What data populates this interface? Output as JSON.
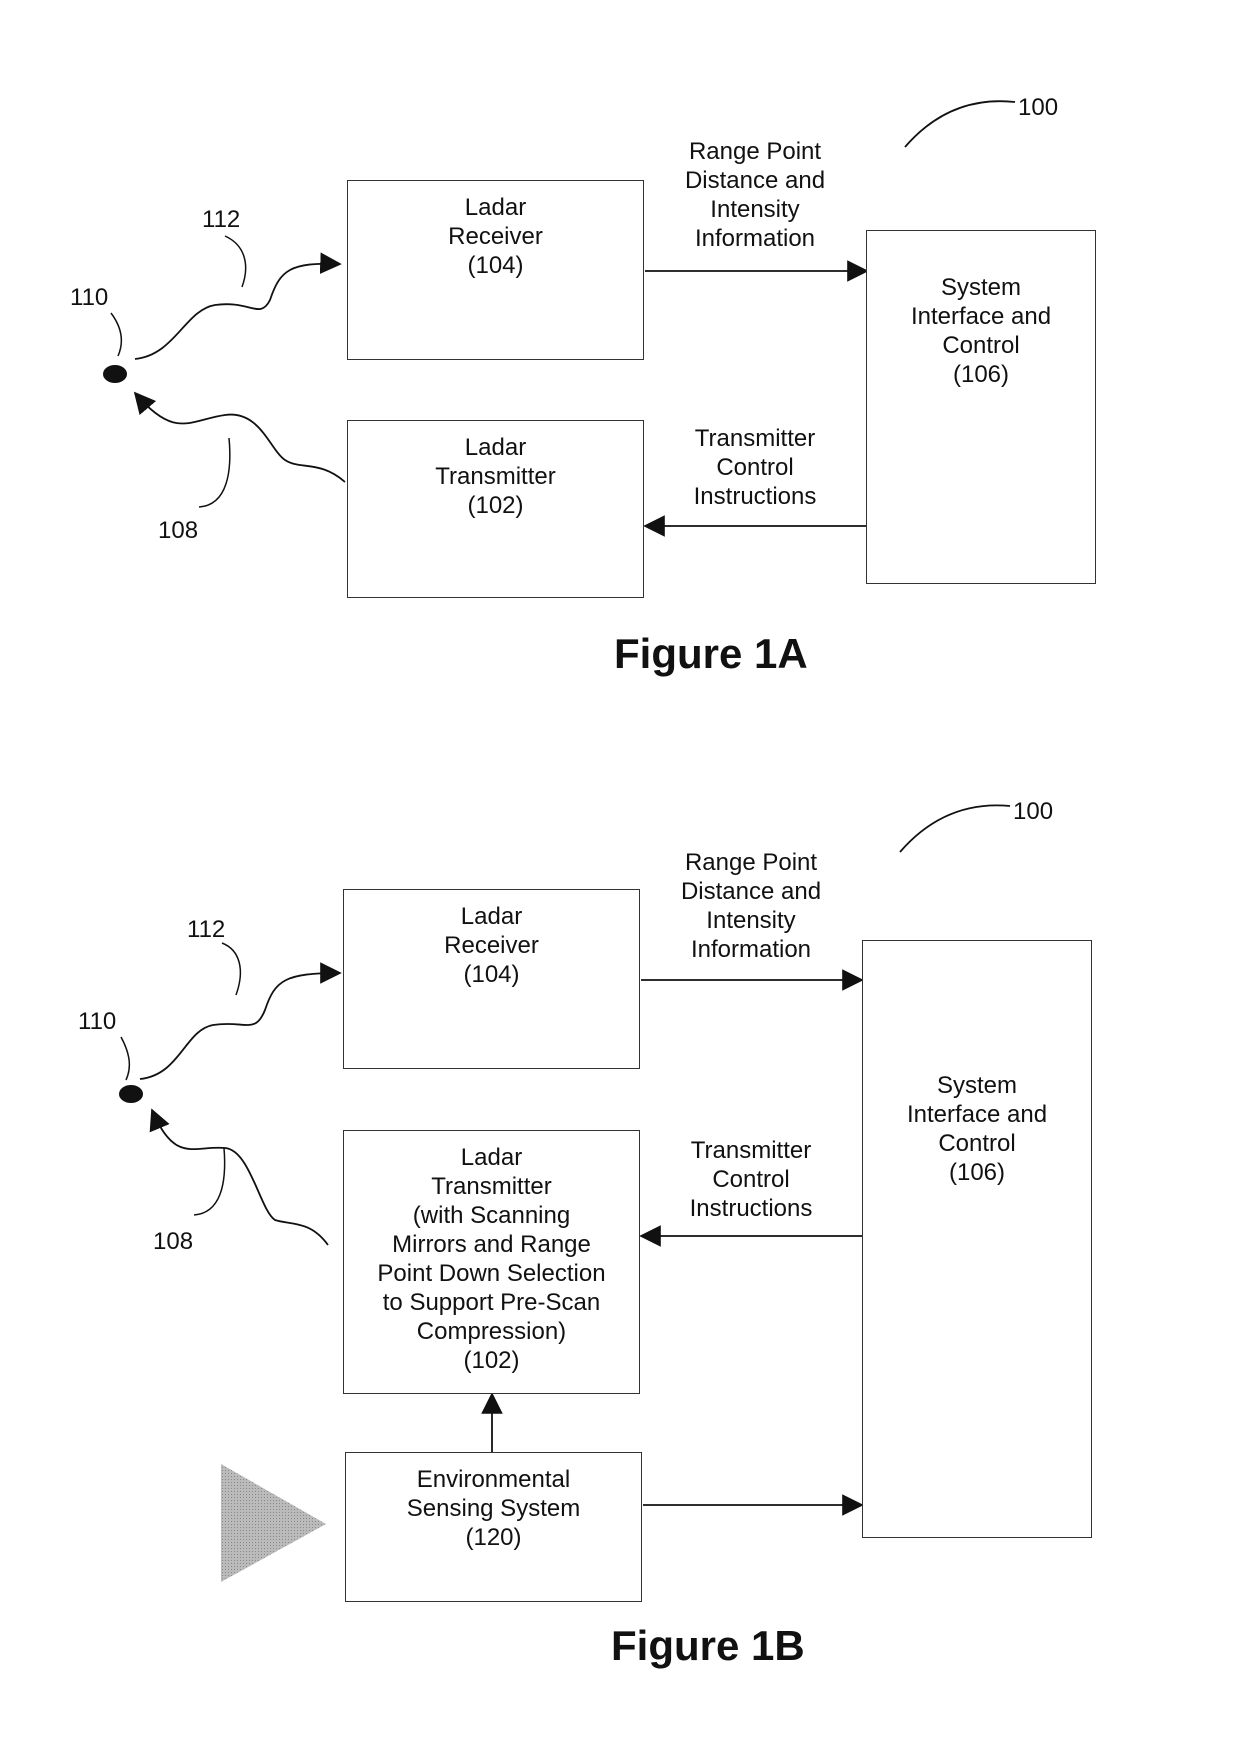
{
  "figure_1a": {
    "title": "Figure 1A",
    "system_ref": "100",
    "receiver": "Ladar\nReceiver\n(104)",
    "transmitter": "Ladar\nTransmitter\n(102)",
    "system": "System\nInterface and\nControl\n(106)",
    "range_label": "Range Point\nDistance and\nIntensity\nInformation",
    "tx_label": "Transmitter\nControl\nInstructions",
    "target_ref": "110",
    "return_ref": "112",
    "pulse_ref": "108"
  },
  "figure_1b": {
    "title": "Figure 1B",
    "system_ref": "100",
    "receiver": "Ladar\nReceiver\n(104)",
    "transmitter": "Ladar\nTransmitter\n(with Scanning\nMirrors and Range\nPoint Down Selection\nto Support Pre-Scan\nCompression)\n(102)",
    "system": "System\nInterface and\nControl\n(106)",
    "env": "Environmental\nSensing System\n(120)",
    "range_label": "Range Point\nDistance and\nIntensity\nInformation",
    "tx_label": "Transmitter\nControl\nInstructions",
    "target_ref": "110",
    "return_ref": "112",
    "pulse_ref": "108"
  }
}
